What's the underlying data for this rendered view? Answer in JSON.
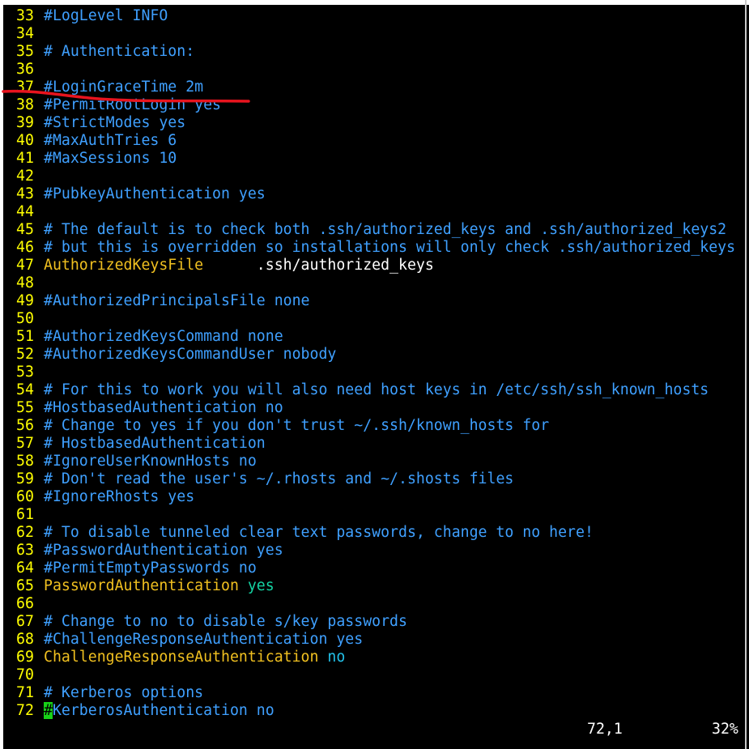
{
  "editor": {
    "lines": [
      {
        "num": "33",
        "segments": [
          {
            "text": "#LogLevel INFO",
            "kind": "comment"
          }
        ]
      },
      {
        "num": "34",
        "segments": []
      },
      {
        "num": "35",
        "segments": [
          {
            "text": "# Authentication:",
            "kind": "comment"
          }
        ]
      },
      {
        "num": "36",
        "segments": []
      },
      {
        "num": "37",
        "segments": [
          {
            "text": "#LoginGraceTime 2m",
            "kind": "comment"
          }
        ]
      },
      {
        "num": "38",
        "segments": [
          {
            "text": "#PermitRootLogin yes",
            "kind": "comment"
          }
        ]
      },
      {
        "num": "39",
        "segments": [
          {
            "text": "#StrictModes yes",
            "kind": "comment"
          }
        ]
      },
      {
        "num": "40",
        "segments": [
          {
            "text": "#MaxAuthTries 6",
            "kind": "comment"
          }
        ]
      },
      {
        "num": "41",
        "segments": [
          {
            "text": "#MaxSessions 10",
            "kind": "comment"
          }
        ]
      },
      {
        "num": "42",
        "segments": []
      },
      {
        "num": "43",
        "segments": [
          {
            "text": "#PubkeyAuthentication yes",
            "kind": "comment"
          }
        ]
      },
      {
        "num": "44",
        "segments": []
      },
      {
        "num": "45",
        "segments": [
          {
            "text": "# The default is to check both .ssh/authorized_keys and .ssh/authorized_keys2",
            "kind": "comment"
          }
        ]
      },
      {
        "num": "46",
        "segments": [
          {
            "text": "# but this is overridden so installations will only check .ssh/authorized_keys",
            "kind": "comment"
          }
        ]
      },
      {
        "num": "47",
        "segments": [
          {
            "text": "AuthorizedKeysFile",
            "kind": "kw"
          },
          {
            "text": "      .ssh/authorized_keys",
            "kind": "val"
          }
        ]
      },
      {
        "num": "48",
        "segments": []
      },
      {
        "num": "49",
        "segments": [
          {
            "text": "#AuthorizedPrincipalsFile none",
            "kind": "comment"
          }
        ]
      },
      {
        "num": "50",
        "segments": []
      },
      {
        "num": "51",
        "segments": [
          {
            "text": "#AuthorizedKeysCommand none",
            "kind": "comment"
          }
        ]
      },
      {
        "num": "52",
        "segments": [
          {
            "text": "#AuthorizedKeysCommandUser nobody",
            "kind": "comment"
          }
        ]
      },
      {
        "num": "53",
        "segments": []
      },
      {
        "num": "54",
        "segments": [
          {
            "text": "# For this to work you will also need host keys in /etc/ssh/ssh_known_hosts",
            "kind": "comment"
          }
        ]
      },
      {
        "num": "55",
        "segments": [
          {
            "text": "#HostbasedAuthentication no",
            "kind": "comment"
          }
        ]
      },
      {
        "num": "56",
        "segments": [
          {
            "text": "# Change to yes if you don't trust ~/.ssh/known_hosts for",
            "kind": "comment"
          }
        ]
      },
      {
        "num": "57",
        "segments": [
          {
            "text": "# HostbasedAuthentication",
            "kind": "comment"
          }
        ]
      },
      {
        "num": "58",
        "segments": [
          {
            "text": "#IgnoreUserKnownHosts no",
            "kind": "comment"
          }
        ]
      },
      {
        "num": "59",
        "segments": [
          {
            "text": "# Don't read the user's ~/.rhosts and ~/.shosts files",
            "kind": "comment"
          }
        ]
      },
      {
        "num": "60",
        "segments": [
          {
            "text": "#IgnoreRhosts yes",
            "kind": "comment"
          }
        ]
      },
      {
        "num": "61",
        "segments": []
      },
      {
        "num": "62",
        "segments": [
          {
            "text": "# To disable tunneled clear text passwords, change to no here!",
            "kind": "comment"
          }
        ]
      },
      {
        "num": "63",
        "segments": [
          {
            "text": "#PasswordAuthentication yes",
            "kind": "comment"
          }
        ]
      },
      {
        "num": "64",
        "segments": [
          {
            "text": "#PermitEmptyPasswords no",
            "kind": "comment"
          }
        ]
      },
      {
        "num": "65",
        "segments": [
          {
            "text": "PasswordAuthentication",
            "kind": "kw"
          },
          {
            "text": " yes",
            "kind": "yes"
          }
        ]
      },
      {
        "num": "66",
        "segments": []
      },
      {
        "num": "67",
        "segments": [
          {
            "text": "# Change to no to disable s/key passwords",
            "kind": "comment"
          }
        ]
      },
      {
        "num": "68",
        "segments": [
          {
            "text": "#ChallengeResponseAuthentication yes",
            "kind": "comment"
          }
        ]
      },
      {
        "num": "69",
        "segments": [
          {
            "text": "ChallengeResponseAuthentication",
            "kind": "kw"
          },
          {
            "text": " no",
            "kind": "no"
          }
        ]
      },
      {
        "num": "70",
        "segments": []
      },
      {
        "num": "71",
        "segments": [
          {
            "text": "# Kerberos options",
            "kind": "comment"
          }
        ]
      },
      {
        "num": "72",
        "segments": [
          {
            "text": "#",
            "kind": "cursor"
          },
          {
            "text": "KerberosAuthentication no",
            "kind": "comment"
          }
        ]
      }
    ]
  },
  "statusbar": {
    "position": "72,1",
    "percent": "32%"
  },
  "annotation": {
    "color": "#e8141e"
  },
  "colors": {
    "background": "#000000",
    "line_number": "#ffff00",
    "comment": "#3fa0ff",
    "keyword": "#f0c020",
    "value": "#ffffff",
    "cursor": "#18d218"
  }
}
